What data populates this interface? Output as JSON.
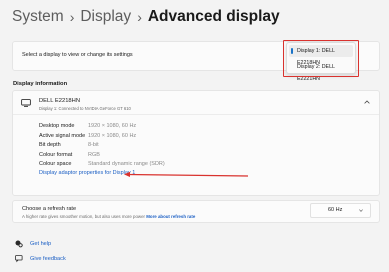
{
  "breadcrumb": {
    "items": [
      "System",
      "Display"
    ],
    "separator": "›",
    "current": "Advanced display"
  },
  "display_select": {
    "label": "Select a display to view or change its settings",
    "options": [
      "Display 1: DELL E2218HN",
      "Display 2: DELL E2221HN"
    ],
    "selected_index": 0
  },
  "display_info": {
    "section_title": "Display information",
    "monitor_name": "DELL E2218HN",
    "monitor_subtitle": "Display 1: Connected to NVIDIA GeForce GT 610",
    "rows": [
      {
        "key": "Desktop mode",
        "value": "1920 × 1080, 60 Hz"
      },
      {
        "key": "Active signal mode",
        "value": "1920 × 1080, 60 Hz"
      },
      {
        "key": "Bit depth",
        "value": "8-bit"
      },
      {
        "key": "Colour format",
        "value": "RGB"
      },
      {
        "key": "Colour space",
        "value": "Standard dynamic range (SDR)"
      }
    ],
    "adaptor_link": "Display adaptor properties for Display 1"
  },
  "refresh_rate": {
    "title": "Choose a refresh rate",
    "subtitle": "A higher rate gives smoother motion, but also uses more power",
    "more_link": "More about refresh rate",
    "value": "60 Hz"
  },
  "footer": {
    "help": "Get help",
    "feedback": "Give feedback"
  },
  "colors": {
    "accent": "#1a73c7",
    "link": "#1b5fc4",
    "annotation_red": "#d9322e"
  }
}
